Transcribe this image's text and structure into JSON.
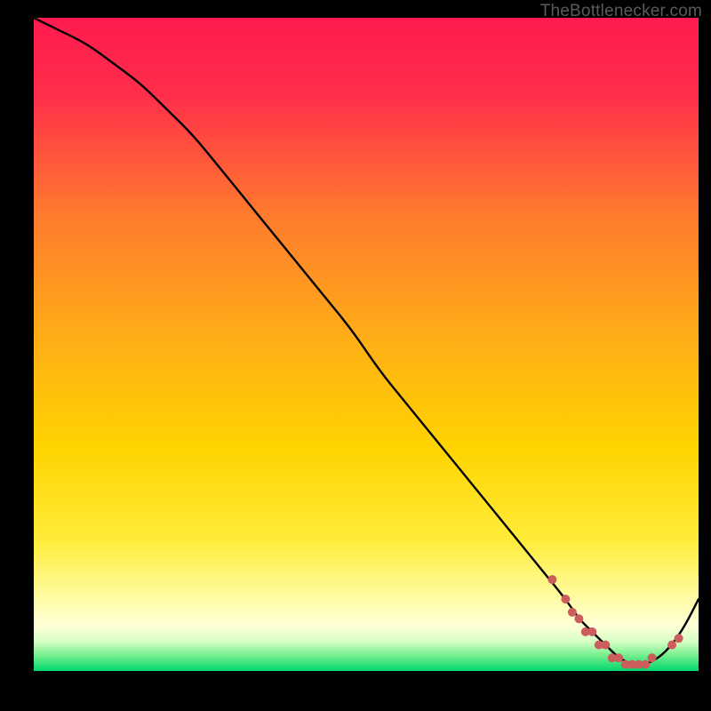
{
  "attribution": "TheBottlenecker.com",
  "colors": {
    "top": "#ff1a4f",
    "mid": "#ffd400",
    "pale": "#ffffbf",
    "green": "#00d66b",
    "curve": "#000000",
    "marker": "#cd5c5c"
  },
  "chart_data": {
    "type": "line",
    "title": "",
    "xlabel": "",
    "ylabel": "",
    "xlim": [
      0,
      100
    ],
    "ylim": [
      0,
      100
    ],
    "x": [
      0,
      4,
      8,
      12,
      16,
      20,
      24,
      28,
      32,
      36,
      40,
      44,
      48,
      52,
      56,
      60,
      64,
      68,
      72,
      76,
      80,
      82,
      84,
      86,
      88,
      90,
      92,
      94,
      96,
      98,
      100
    ],
    "y": [
      100,
      98,
      96,
      93,
      90,
      86,
      82,
      77,
      72,
      67,
      62,
      57,
      52,
      46,
      41,
      36,
      31,
      26,
      21,
      16,
      11,
      8,
      6,
      4,
      2,
      1,
      1,
      2,
      4,
      7,
      11
    ],
    "markers_x": [
      78,
      80,
      81,
      82,
      83,
      84,
      85,
      86,
      87,
      88,
      89,
      90,
      91,
      92,
      93,
      96,
      97
    ],
    "markers_y": [
      14,
      11,
      9,
      8,
      6,
      6,
      4,
      4,
      2,
      2,
      1,
      1,
      1,
      1,
      2,
      4,
      5
    ]
  }
}
